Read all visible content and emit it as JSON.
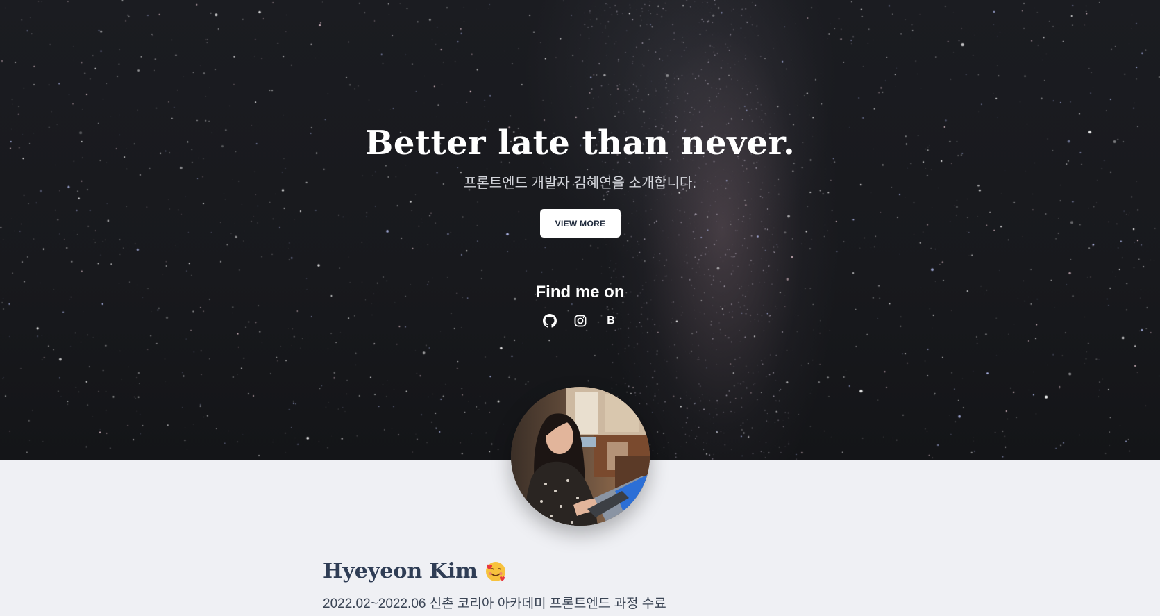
{
  "hero": {
    "title": "Better late than never.",
    "subtitle": "프론트엔드 개발자 김혜연을 소개합니다.",
    "cta_label": "VIEW MORE",
    "find_title": "Find me on",
    "socials": [
      {
        "name": "github",
        "icon": "github-icon"
      },
      {
        "name": "instagram",
        "icon": "instagram-icon"
      },
      {
        "name": "blog",
        "label": "B"
      }
    ]
  },
  "profile": {
    "avatar": "profile-photo",
    "name": "Hyeyeon Kim",
    "emoji": "smiling-face-with-hearts",
    "history_line": "2022.02~2022.06 신촌 코리아 아카데미 프론트엔드 과정 수료"
  },
  "colors": {
    "hero_bg": "#1b1c21",
    "page_bg": "#eff0f4",
    "heading_dark": "#2f3d55"
  }
}
